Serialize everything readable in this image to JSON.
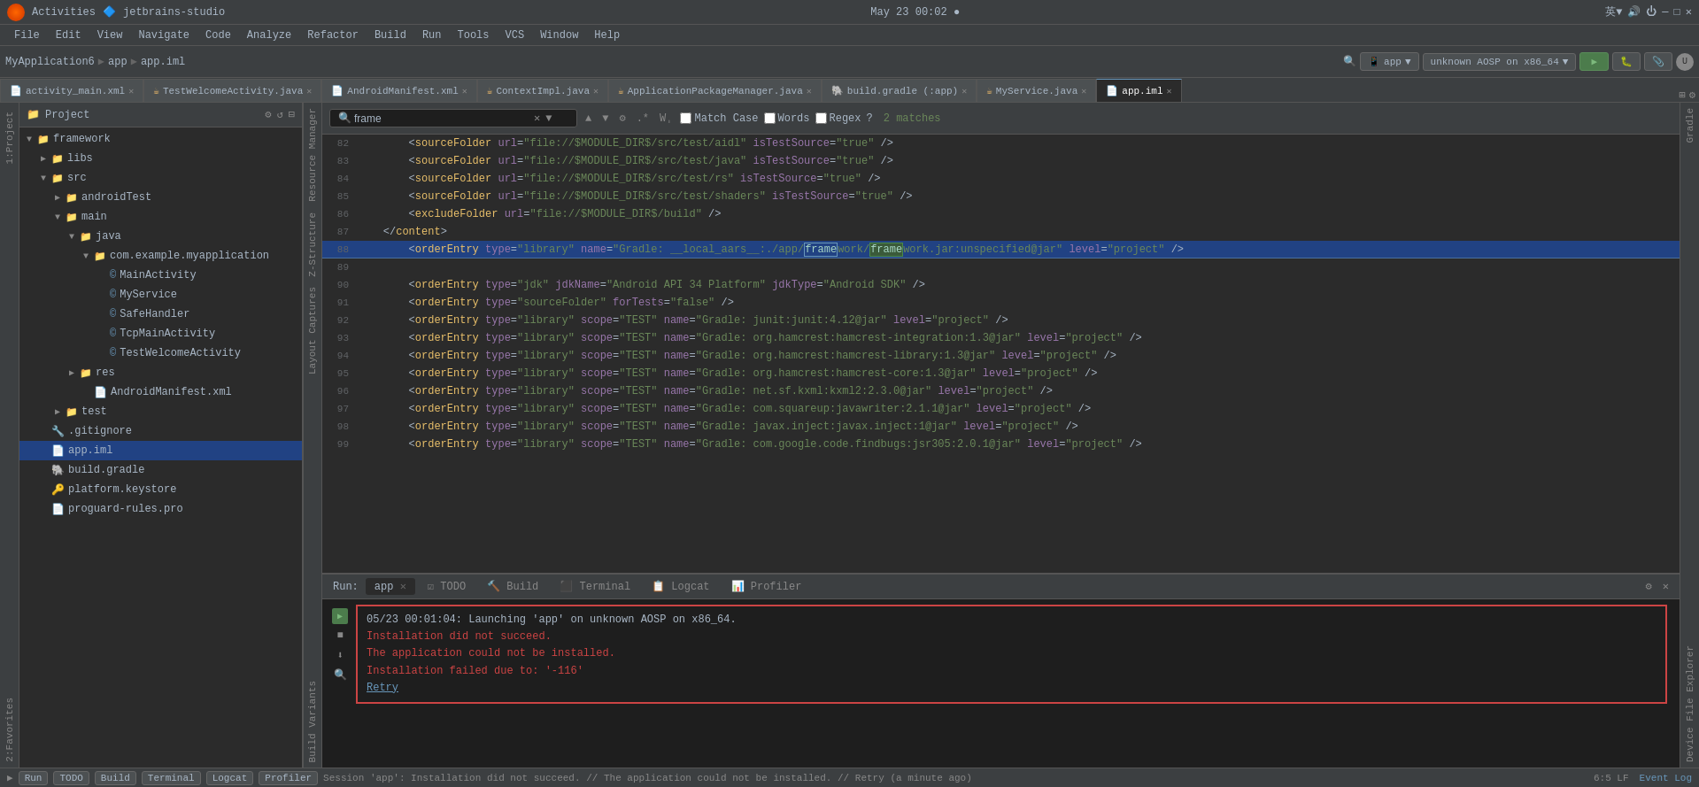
{
  "system_bar": {
    "left": "Activities",
    "app_title": "jetbrains-studio",
    "center": "May 23  00:02  ●",
    "right_labels": [
      "英▼",
      "🔊",
      "⏻"
    ]
  },
  "menu": {
    "items": [
      "File",
      "Edit",
      "View",
      "Navigate",
      "Code",
      "Analyze",
      "Refactor",
      "Build",
      "Run",
      "Tools",
      "VCS",
      "Window",
      "Help"
    ]
  },
  "toolbar": {
    "breadcrumb": [
      "MyApplication6",
      "app",
      "app.iml"
    ],
    "run_config": "app",
    "device": "unknown AOSP on x86_64"
  },
  "tabs": [
    {
      "label": "activity_main.xml",
      "modified": false
    },
    {
      "label": "TestWelcomeActivity.java",
      "modified": false
    },
    {
      "label": "AndroidManifest.xml",
      "modified": false
    },
    {
      "label": "ContextImpl.java",
      "modified": false
    },
    {
      "label": "ApplicationPackageManager.java",
      "modified": false
    },
    {
      "label": "build.gradle (:app)",
      "modified": false
    },
    {
      "label": "MyService.java",
      "modified": false
    },
    {
      "label": "app.iml",
      "active": true,
      "modified": false
    }
  ],
  "search": {
    "query": "frame",
    "match_case_label": "Match Case",
    "words_label": "Words",
    "regex_label": "Regex",
    "matches": "2 matches"
  },
  "project_panel": {
    "title": "Project",
    "tree": [
      {
        "indent": 0,
        "type": "folder",
        "label": "framework",
        "expanded": true
      },
      {
        "indent": 1,
        "type": "folder",
        "label": "libs"
      },
      {
        "indent": 1,
        "type": "folder",
        "label": "src",
        "expanded": true
      },
      {
        "indent": 2,
        "type": "folder",
        "label": "androidTest"
      },
      {
        "indent": 2,
        "type": "folder",
        "label": "main",
        "expanded": true
      },
      {
        "indent": 3,
        "type": "folder",
        "label": "java",
        "expanded": true
      },
      {
        "indent": 4,
        "type": "folder",
        "label": "com.example.myapplication",
        "expanded": true
      },
      {
        "indent": 5,
        "type": "class",
        "label": "MainActivity"
      },
      {
        "indent": 5,
        "type": "class",
        "label": "MyService"
      },
      {
        "indent": 5,
        "type": "class",
        "label": "SafeHandler"
      },
      {
        "indent": 5,
        "type": "class",
        "label": "TcpMainActivity"
      },
      {
        "indent": 5,
        "type": "class",
        "label": "TestWelcomeActivity"
      },
      {
        "indent": 3,
        "type": "folder",
        "label": "res"
      },
      {
        "indent": 4,
        "type": "file",
        "label": "AndroidManifest.xml"
      },
      {
        "indent": 2,
        "type": "folder",
        "label": "test"
      },
      {
        "indent": 1,
        "type": "file",
        "label": ".gitignore"
      },
      {
        "indent": 1,
        "type": "file",
        "label": "app.iml",
        "selected": true
      },
      {
        "indent": 1,
        "type": "file",
        "label": "build.gradle"
      },
      {
        "indent": 1,
        "type": "file",
        "label": "platform.keystore"
      },
      {
        "indent": 1,
        "type": "file",
        "label": "proguard-rules.pro"
      }
    ]
  },
  "code_lines": [
    {
      "num": 82,
      "content": "        <sourceFolder url=\"file://$MODULE_DIR$/src/test/aidl\" isTestSource=\"true\" />"
    },
    {
      "num": 83,
      "content": "        <sourceFolder url=\"file://$MODULE_DIR$/src/test/java\" isTestSource=\"true\" />"
    },
    {
      "num": 84,
      "content": "        <sourceFolder url=\"file://$MODULE_DIR$/src/test/rs\" isTestSource=\"true\" />"
    },
    {
      "num": 85,
      "content": "        <sourceFolder url=\"file://$MODULE_DIR$/src/test/shaders\" isTestSource=\"true\" />"
    },
    {
      "num": 86,
      "content": "        <excludeFolder url=\"file://$MODULE_DIR$/build\" />"
    },
    {
      "num": 87,
      "content": "    </content>"
    },
    {
      "num": 88,
      "content": "        <orderEntry type=\"library\" name=\"Gradle: __local_aars__:./app/framework/framework.jar:unspecified@jar\" level=\"project\" />",
      "highlight": true
    },
    {
      "num": 89,
      "content": ""
    },
    {
      "num": 90,
      "content": "        <orderEntry type=\"jdk\" jdkName=\"Android API 34 Platform\" jdkType=\"Android SDK\" />"
    },
    {
      "num": 91,
      "content": "        <orderEntry type=\"sourceFolder\" forTests=\"false\" />"
    },
    {
      "num": 92,
      "content": "        <orderEntry type=\"library\" scope=\"TEST\" name=\"Gradle: junit:junit:4.12@jar\" level=\"project\" />"
    },
    {
      "num": 93,
      "content": "        <orderEntry type=\"library\" scope=\"TEST\" name=\"Gradle: org.hamcrest:hamcrest-integration:1.3@jar\" level=\"project\" />"
    },
    {
      "num": 94,
      "content": "        <orderEntry type=\"library\" scope=\"TEST\" name=\"Gradle: org.hamcrest:hamcrest-library:1.3@jar\" level=\"project\" />"
    },
    {
      "num": 95,
      "content": "        <orderEntry type=\"library\" scope=\"TEST\" name=\"Gradle: org.hamcrest:hamcrest-core:1.3@jar\" level=\"project\" />"
    },
    {
      "num": 96,
      "content": "        <orderEntry type=\"library\" scope=\"TEST\" name=\"Gradle: net.sf.kxml:kxml2:2.3.0@jar\" level=\"project\" />"
    },
    {
      "num": 97,
      "content": "        <orderEntry type=\"library\" scope=\"TEST\" name=\"Gradle: com.squareup:javawriter:2.1.1@jar\" level=\"project\" />"
    },
    {
      "num": 98,
      "content": "        <orderEntry type=\"library\" scope=\"TEST\" name=\"Gradle: javax.inject:javax.inject:1@jar\" level=\"project\" />"
    },
    {
      "num": 99,
      "content": "        <orderEntry type=\"library\" scope=\"TEST\" name=\"Gradle: com.google.code.findbugs:jsr305:2.0.1@jar\" level=\"project\" />"
    }
  ],
  "run_panel": {
    "title": "Run:",
    "active_tab": "app",
    "tabs": [
      "Run:",
      "app",
      "TODO",
      "Build",
      "Terminal",
      "Logcat",
      "Profiler"
    ],
    "output_lines": [
      "05/23 00:01:04: Launching 'app' on unknown AOSP on x86_64.",
      "Installation did not succeed.",
      "The application could not be installed.",
      "Installation failed due to: '-116'",
      "Retry"
    ]
  },
  "status_bar": {
    "text": "Session 'app': Installation did not succeed. // The application could not be installed. // Retry (a minute ago)",
    "right": "6:5  LF"
  },
  "left_panels": [
    "1:Project",
    "2:Favorites"
  ],
  "right_panels": [
    "Gradle",
    "Device File Explorer"
  ],
  "middle_panels": [
    "Resource Manager",
    "Z-Structure",
    "Layout Captures",
    "Build Variants"
  ]
}
